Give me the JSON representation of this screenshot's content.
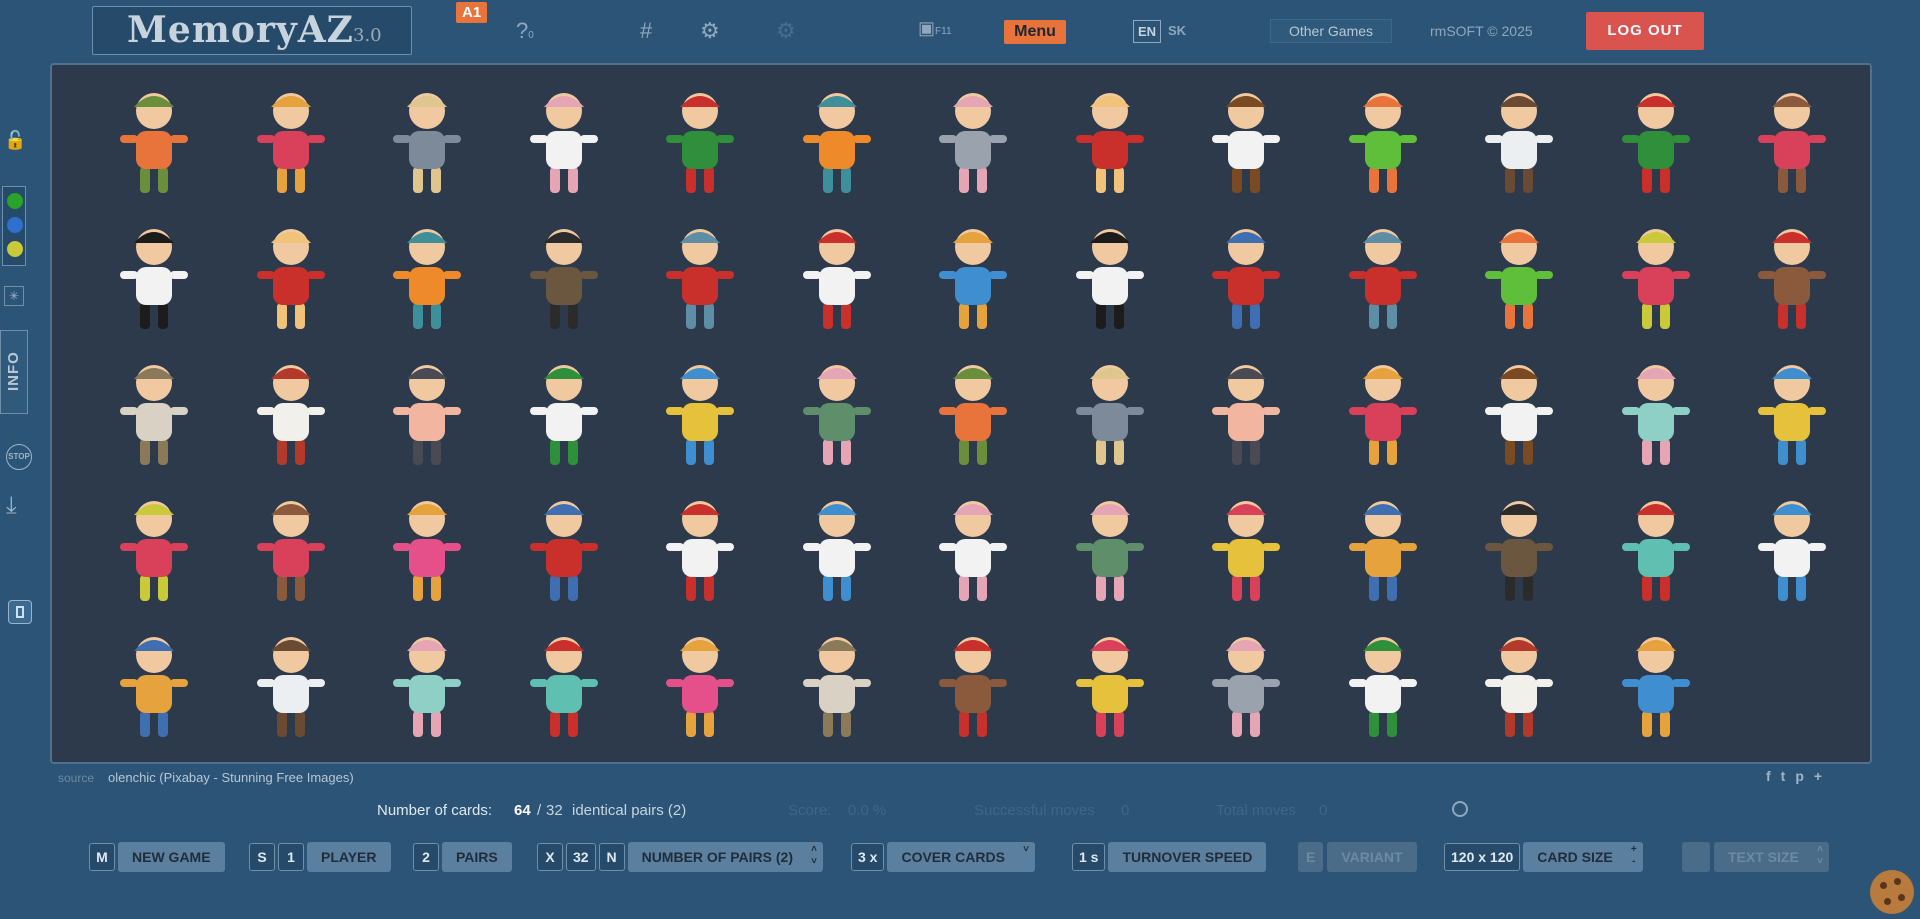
{
  "header": {
    "logo_text": "MemoryAZ",
    "logo_version": "3.0",
    "level_badge": "A1",
    "help_label": "?",
    "help_count": "0",
    "numbers_label": "#",
    "fullscreen_hint": "F11",
    "menu_label": "Menu",
    "lang_en": "EN",
    "lang_sk": "SK",
    "other_games_label": "Other Games",
    "copyright": "rmSOFT © 2025",
    "logout_label": "LOG OUT"
  },
  "sidebar": {
    "info_label": "INFO",
    "stop_label": "STOP",
    "colors": [
      "#2aa32a",
      "#2f6fd0",
      "#c9c93a"
    ]
  },
  "board": {
    "card_size": 120,
    "cards": [
      "hiker",
      "rollerskater",
      "schoolgirl",
      "bunny",
      "leprechaun",
      "tiger",
      "mouse",
      "strongman",
      "captain",
      "crocodile",
      "astronaut",
      "leprechaun",
      "headphone-girl",
      "panda",
      "strongman",
      "tiger",
      "owl",
      "scarf-man",
      "chef-cupcakes",
      "pencil-girl",
      "panda",
      "cyclist",
      "scarf-man",
      "crocodile",
      "traveler",
      "bbq-man",
      "grandpa",
      "polar-bear",
      "fitness-girl",
      "pizza-chef",
      "vacuum-robot",
      "shy-couple",
      "hiker",
      "schoolgirl",
      "fitness-girl",
      "rollerskater",
      "captain",
      "happy-girl",
      "vacuum-robot",
      "traveler",
      "headphone-girl",
      "dog-walker",
      "cyclist",
      "chef-cupcakes",
      "doctor",
      "bunny",
      "shy-couple",
      "blonde-girl",
      "pregnant-woman",
      "owl",
      "thermometer-boy",
      "doctor",
      "pregnant-woman",
      "astronaut",
      "happy-girl",
      "thermometer-boy",
      "dog-walker",
      "grandpa",
      "bbq-man",
      "blonde-girl",
      "mouse",
      "pizza-chef",
      "polar-bear",
      "pencil-girl"
    ],
    "palette": {
      "hiker": [
        "#e8743b",
        "#6b8e3d"
      ],
      "rollerskater": [
        "#d9415a",
        "#e6a23c"
      ],
      "schoolgirl": [
        "#7c8a99",
        "#e0c58f"
      ],
      "bunny": [
        "#f2f2f2",
        "#e6a5b5"
      ],
      "leprechaun": [
        "#2f8f3a",
        "#c9302c"
      ],
      "tiger": [
        "#ef8a2a",
        "#3f8f9a"
      ],
      "mouse": [
        "#9aa3ad",
        "#e6a5b5"
      ],
      "strongman": [
        "#c9302c",
        "#f0c27a"
      ],
      "captain": [
        "#f2f2f2",
        "#7a4a22"
      ],
      "crocodile": [
        "#5fbf3a",
        "#e8743b"
      ],
      "astronaut": [
        "#eceff1",
        "#6b4a33"
      ],
      "headphone-girl": [
        "#d9415a",
        "#8b5a3c"
      ],
      "panda": [
        "#f2f2f2",
        "#1c1c1c"
      ],
      "owl": [
        "#6b5640",
        "#2b2b2b"
      ],
      "scarf-man": [
        "#c9302c",
        "#5e8ea6"
      ],
      "chef-cupcakes": [
        "#f2f2f2",
        "#c9302c"
      ],
      "pencil-girl": [
        "#3f8fd0",
        "#e6a23c"
      ],
      "cyclist": [
        "#c9302c",
        "#3f6fb0"
      ],
      "traveler": [
        "#d9415a",
        "#c9c93a"
      ],
      "bbq-man": [
        "#8b5a3c",
        "#c9302c"
      ],
      "grandpa": [
        "#d9d2c4",
        "#8a7a5a"
      ],
      "polar-bear": [
        "#f2f0ea",
        "#b33a2a"
      ],
      "fitness-girl": [
        "#f2b6a0",
        "#4a4a55"
      ],
      "pizza-chef": [
        "#f2f2f2",
        "#2f8f3a"
      ],
      "vacuum-robot": [
        "#e6c23c",
        "#3f8fd0"
      ],
      "shy-couple": [
        "#5e8e6a",
        "#e6a5b5"
      ],
      "happy-girl": [
        "#8fd0c6",
        "#e6a5b5"
      ],
      "dog-walker": [
        "#e6508a",
        "#e6a23c"
      ],
      "doctor": [
        "#f2f2f2",
        "#3f8fd0"
      ],
      "blonde-girl": [
        "#e6c23c",
        "#d9415a"
      ],
      "pregnant-woman": [
        "#e6a23c",
        "#3f6fb0"
      ],
      "thermometer-boy": [
        "#5fbfb0",
        "#c9302c"
      ]
    }
  },
  "source": {
    "label": "source",
    "value": "olenchic (Pixabay - Stunning Free Images)"
  },
  "social": [
    "f",
    "t",
    "p",
    "+"
  ],
  "stats": {
    "cards_label": "Number of cards:",
    "cards_value": "64",
    "pairs_value": "32",
    "pairs_text": "identical pairs (2)",
    "separator": "/",
    "score_label": "Score:",
    "score_value": "0.0 %",
    "successful_label": "Successful moves",
    "successful_value": "0",
    "total_label": "Total moves",
    "total_value": "0"
  },
  "controls": {
    "new_game_key": "M",
    "new_game_label": "NEW GAME",
    "player_key": "S",
    "player_value": "1",
    "player_label": "PLAYER",
    "pairs_value": "2",
    "pairs_label": "PAIRS",
    "x_key": "X",
    "num_pairs_value": "32",
    "n_key": "N",
    "num_pairs_label": "NUMBER OF PAIRS (2)",
    "cover_value": "3 x",
    "cover_label": "COVER CARDS",
    "speed_value": "1 s",
    "speed_label": "TURNOVER SPEED",
    "variant_key": "E",
    "variant_label": "VARIANT",
    "size_value": "120 x 120",
    "size_label": "CARD SIZE",
    "text_size_label": "TEXT SIZE"
  }
}
